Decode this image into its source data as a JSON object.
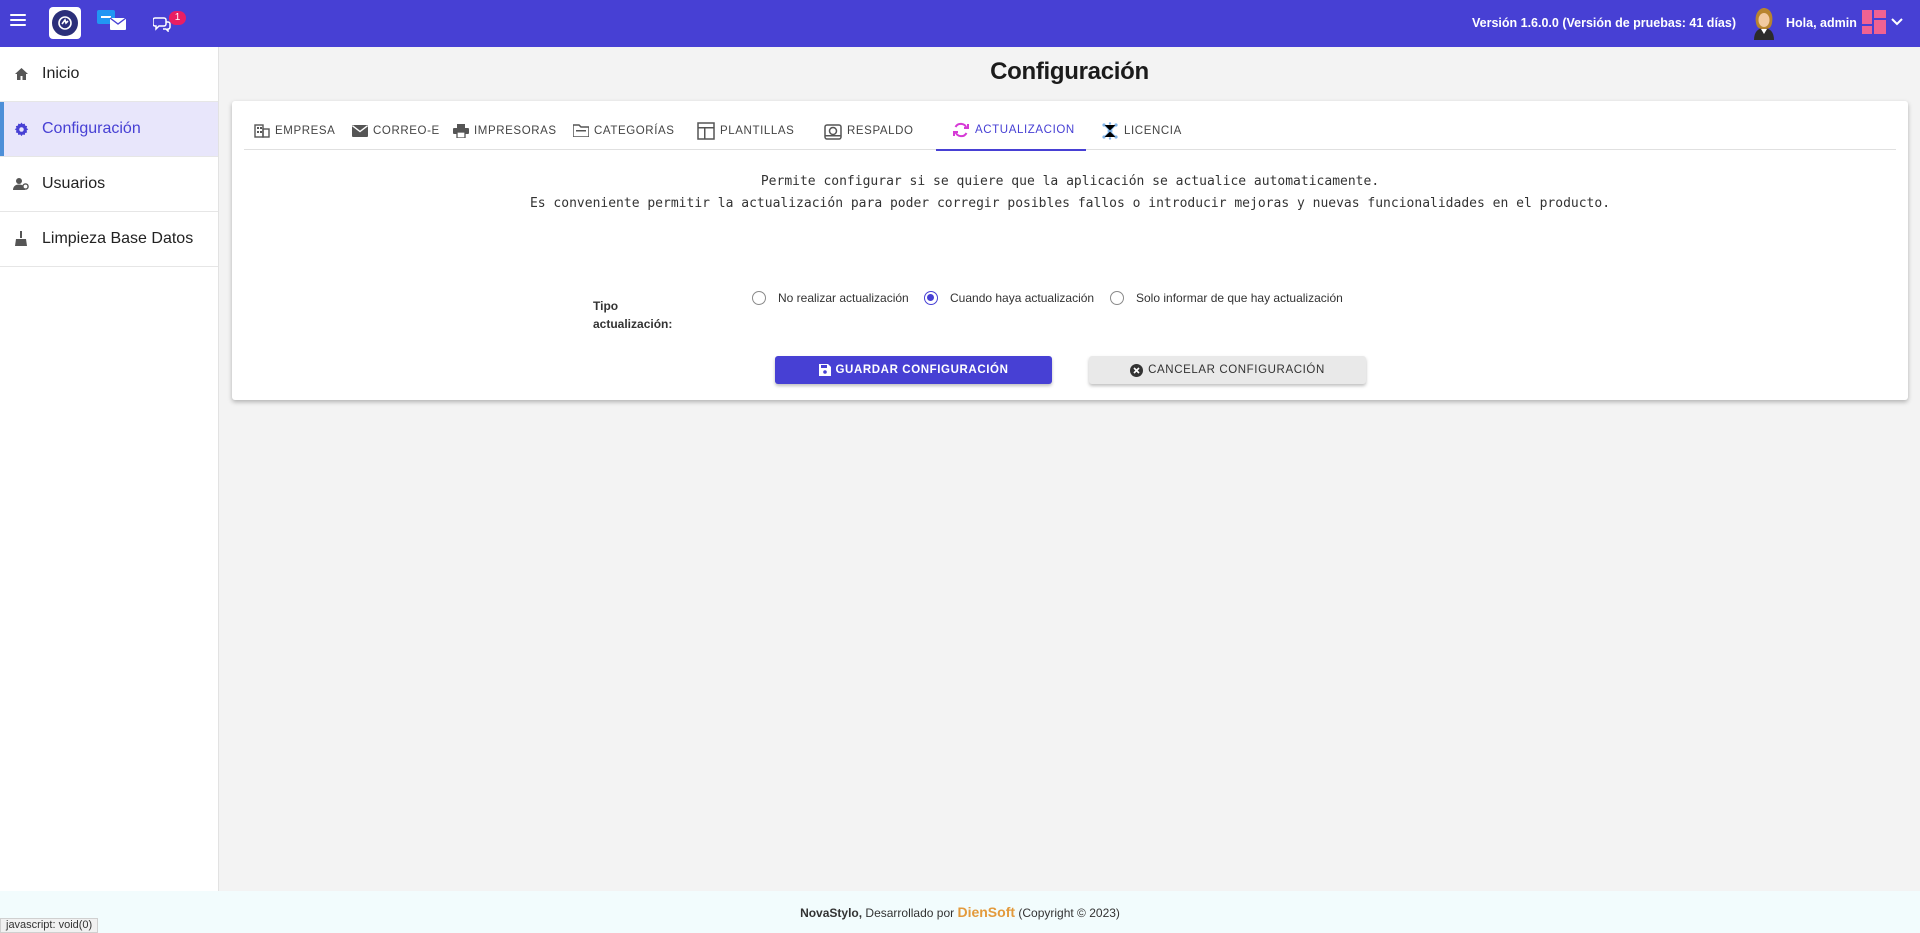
{
  "topbar": {
    "chat_badge": "1",
    "version": "Versión 1.6.0.0 (Versión de pruebas: 41 días)",
    "greeting": "Hola, admin",
    "color": "#4740d4"
  },
  "sidebar": {
    "items": [
      {
        "label": "Inicio",
        "icon": "home-icon"
      },
      {
        "label": "Configuración",
        "icon": "gear-icon",
        "active": true
      },
      {
        "label": "Usuarios",
        "icon": "users-gear-icon"
      },
      {
        "label": "Limpieza Base Datos",
        "icon": "broom-icon"
      }
    ]
  },
  "main": {
    "title": "Configuración",
    "tabs": [
      {
        "label": "EMPRESA",
        "icon": "building-icon"
      },
      {
        "label": "CORREO-E",
        "icon": "envelope-icon"
      },
      {
        "label": "IMPRESORAS",
        "icon": "printer-icon"
      },
      {
        "label": "CATEGORÍAS",
        "icon": "folder-icon"
      },
      {
        "label": "PLANTILLAS",
        "icon": "template-icon"
      },
      {
        "label": "RESPALDO",
        "icon": "backup-icon"
      },
      {
        "label": "ACTUALIZACION",
        "icon": "sync-icon",
        "active": true
      },
      {
        "label": "LICENCIA",
        "icon": "license-icon"
      }
    ],
    "description": [
      "Permite configurar si se quiere que la aplicación se actualice automaticamente.",
      "Es conveniente permitir la actualización para poder corregir posibles fallos o introducir mejoras y nuevas funcionalidades en el producto."
    ],
    "update_type": {
      "label_line1": "Tipo",
      "label_line2": "actualización:",
      "options": [
        {
          "label": "No realizar actualización",
          "checked": false
        },
        {
          "label": "Cuando haya actualización",
          "checked": true
        },
        {
          "label": "Solo informar de que hay actualización",
          "checked": false
        }
      ]
    },
    "buttons": {
      "save": "GUARDAR CONFIGURACIÓN",
      "cancel": "CANCELAR CONFIGURACIÓN"
    }
  },
  "footer": {
    "brand": "NovaStylo,",
    "developed_by": " Desarrollado por ",
    "developer": "DienSoft",
    "copyright": " (Copyright © 2023)"
  },
  "statusbar": {
    "text": "javascript: void(0)"
  }
}
